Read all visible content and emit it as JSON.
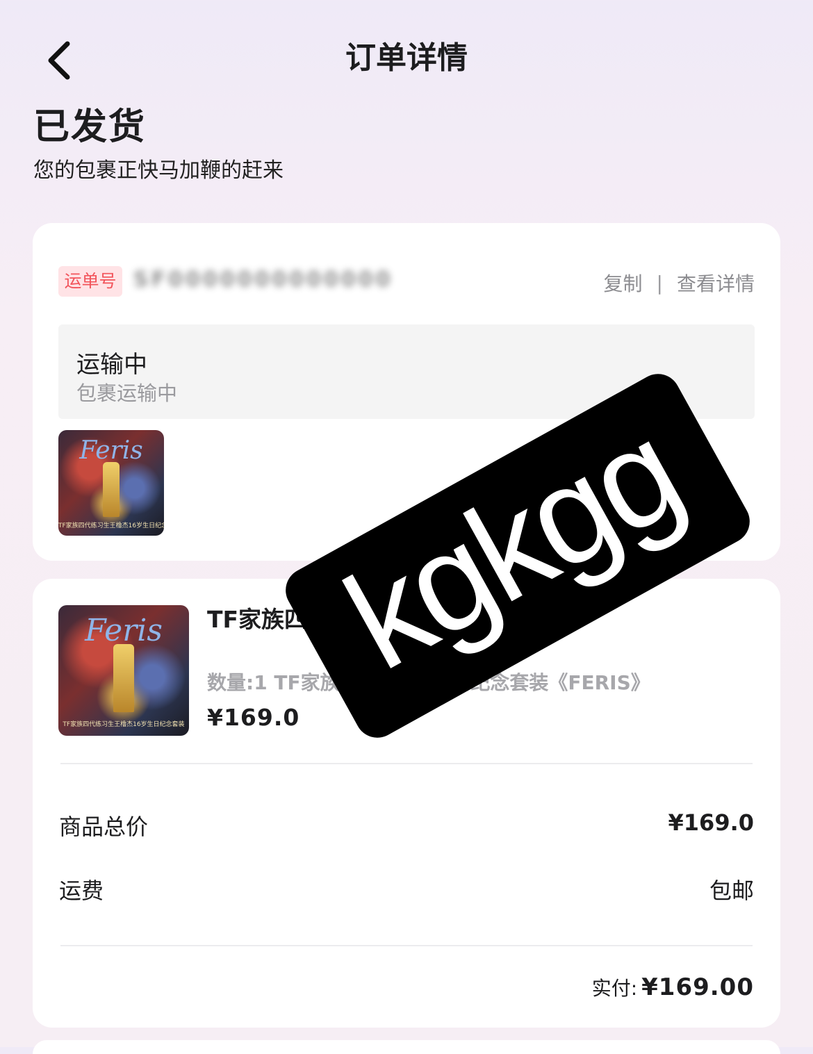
{
  "header": {
    "title": "订单详情"
  },
  "status": {
    "title": "已发货",
    "subtitle": "您的包裹正快马加鞭的赶来"
  },
  "shipping": {
    "badge": "运单号",
    "tracking_number": "SF0000000000000",
    "copy_label": "复制",
    "separator": "|",
    "detail_label": "查看详情",
    "transit_title": "运输中",
    "transit_subtitle": "包裹运输中"
  },
  "product": {
    "cover_logo": "Feris",
    "cover_caption": "TF家族四代练习生王橹杰16岁生日纪念套装",
    "title": "TF家族四                                      念套装 《FERIS》",
    "spec": "数量:1 TF家族                  橹杰16岁生日纪念套装《FERIS》",
    "price": "¥169.0"
  },
  "summary": {
    "goods_total_label": "商品总价",
    "goods_total_value": "¥169.0",
    "shipping_fee_label": "运费",
    "shipping_fee_value": "包邮",
    "paid_label": "实付:",
    "paid_value": "¥169.00"
  },
  "watermark": {
    "text": "kgkgg"
  },
  "icons": {
    "back": "chevron-left-icon"
  }
}
